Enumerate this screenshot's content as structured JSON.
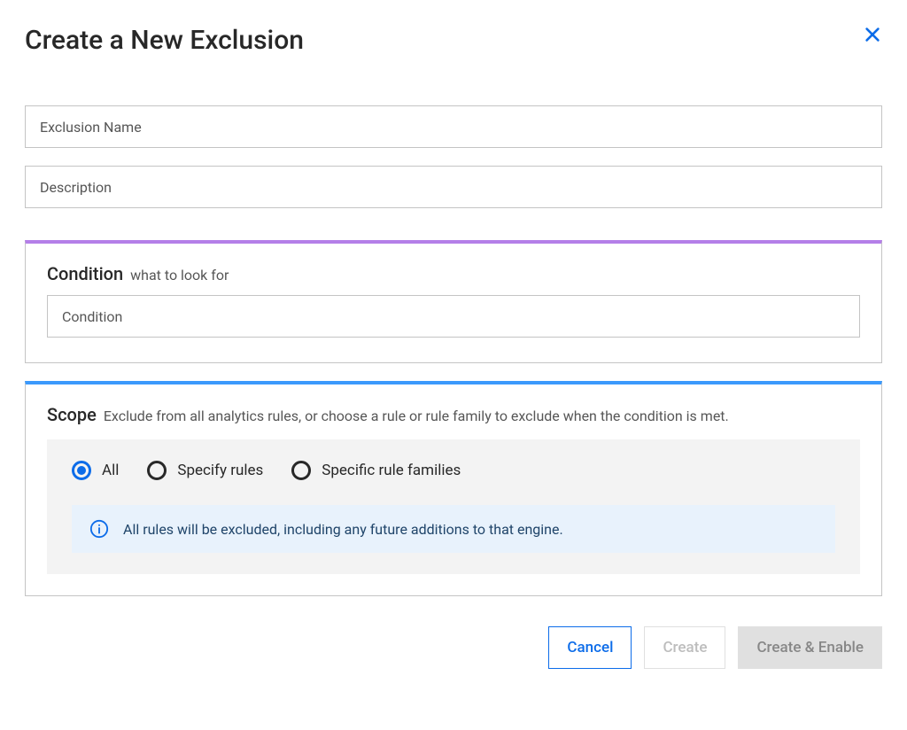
{
  "header": {
    "title": "Create a New Exclusion"
  },
  "fields": {
    "exclusion_name_placeholder": "Exclusion Name",
    "description_placeholder": "Description"
  },
  "condition": {
    "label": "Condition",
    "hint": "what to look for",
    "placeholder": "Condition"
  },
  "scope": {
    "label": "Scope",
    "hint": "Exclude from all analytics rules, or choose a rule or rule family to exclude when the condition is met.",
    "options": {
      "all": "All",
      "specify_rules": "Specify rules",
      "specific_families": "Specific rule families"
    },
    "selected": "all",
    "info_message": "All rules will be excluded, including any future additions to that engine."
  },
  "footer": {
    "cancel": "Cancel",
    "create": "Create",
    "create_enable": "Create & Enable"
  }
}
